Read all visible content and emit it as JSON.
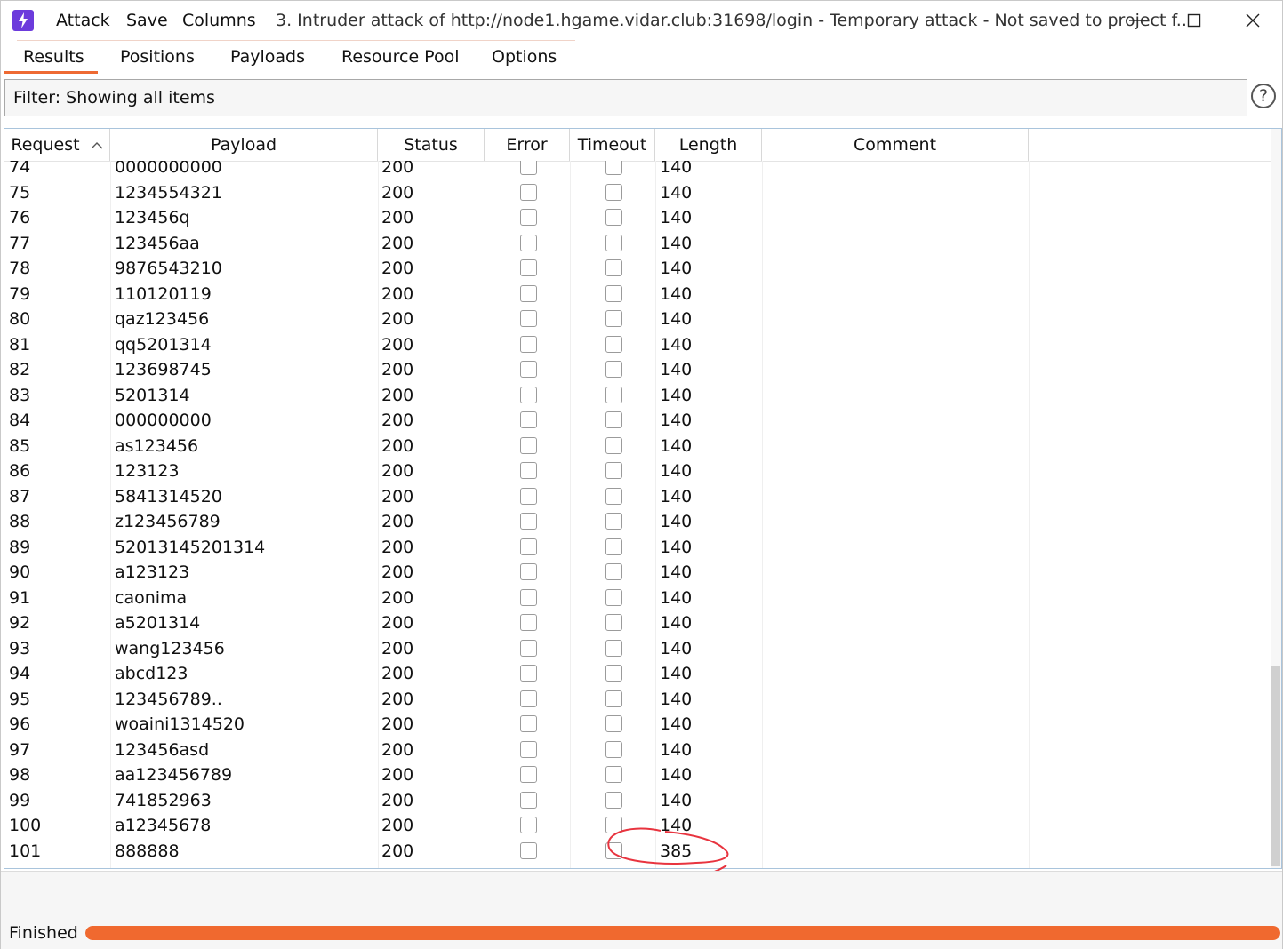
{
  "window": {
    "title": "3. Intruder attack of http://node1.hgame.vidar.club:31698/login - Temporary attack - Not saved to project f..",
    "menu": [
      "Attack",
      "Save",
      "Columns"
    ],
    "app_icon": "burp-lightning-icon"
  },
  "tabs": [
    "Results",
    "Positions",
    "Payloads",
    "Resource Pool",
    "Options"
  ],
  "active_tab": "Results",
  "filter": {
    "text": "Filter: Showing all items"
  },
  "table": {
    "columns": [
      "Request",
      "Payload",
      "Status",
      "Error",
      "Timeout",
      "Length",
      "Comment"
    ],
    "sort_column": "Request",
    "sort_direction": "ascending",
    "rows": [
      {
        "request": "74",
        "payload": "0000000000",
        "status": "200",
        "error": false,
        "timeout": false,
        "length": "140"
      },
      {
        "request": "75",
        "payload": "1234554321",
        "status": "200",
        "error": false,
        "timeout": false,
        "length": "140"
      },
      {
        "request": "76",
        "payload": "123456q",
        "status": "200",
        "error": false,
        "timeout": false,
        "length": "140"
      },
      {
        "request": "77",
        "payload": "123456aa",
        "status": "200",
        "error": false,
        "timeout": false,
        "length": "140"
      },
      {
        "request": "78",
        "payload": "9876543210",
        "status": "200",
        "error": false,
        "timeout": false,
        "length": "140"
      },
      {
        "request": "79",
        "payload": "110120119",
        "status": "200",
        "error": false,
        "timeout": false,
        "length": "140"
      },
      {
        "request": "80",
        "payload": "qaz123456",
        "status": "200",
        "error": false,
        "timeout": false,
        "length": "140"
      },
      {
        "request": "81",
        "payload": "qq5201314",
        "status": "200",
        "error": false,
        "timeout": false,
        "length": "140"
      },
      {
        "request": "82",
        "payload": "123698745",
        "status": "200",
        "error": false,
        "timeout": false,
        "length": "140"
      },
      {
        "request": "83",
        "payload": "5201314",
        "status": "200",
        "error": false,
        "timeout": false,
        "length": "140"
      },
      {
        "request": "84",
        "payload": "000000000",
        "status": "200",
        "error": false,
        "timeout": false,
        "length": "140"
      },
      {
        "request": "85",
        "payload": "as123456",
        "status": "200",
        "error": false,
        "timeout": false,
        "length": "140"
      },
      {
        "request": "86",
        "payload": "123123",
        "status": "200",
        "error": false,
        "timeout": false,
        "length": "140"
      },
      {
        "request": "87",
        "payload": "5841314520",
        "status": "200",
        "error": false,
        "timeout": false,
        "length": "140"
      },
      {
        "request": "88",
        "payload": "z123456789",
        "status": "200",
        "error": false,
        "timeout": false,
        "length": "140"
      },
      {
        "request": "89",
        "payload": "52013145201314",
        "status": "200",
        "error": false,
        "timeout": false,
        "length": "140"
      },
      {
        "request": "90",
        "payload": "a123123",
        "status": "200",
        "error": false,
        "timeout": false,
        "length": "140"
      },
      {
        "request": "91",
        "payload": "caonima",
        "status": "200",
        "error": false,
        "timeout": false,
        "length": "140"
      },
      {
        "request": "92",
        "payload": "a5201314",
        "status": "200",
        "error": false,
        "timeout": false,
        "length": "140"
      },
      {
        "request": "93",
        "payload": "wang123456",
        "status": "200",
        "error": false,
        "timeout": false,
        "length": "140"
      },
      {
        "request": "94",
        "payload": "abcd123",
        "status": "200",
        "error": false,
        "timeout": false,
        "length": "140"
      },
      {
        "request": "95",
        "payload": "123456789..",
        "status": "200",
        "error": false,
        "timeout": false,
        "length": "140"
      },
      {
        "request": "96",
        "payload": "woaini1314520",
        "status": "200",
        "error": false,
        "timeout": false,
        "length": "140"
      },
      {
        "request": "97",
        "payload": "123456asd",
        "status": "200",
        "error": false,
        "timeout": false,
        "length": "140"
      },
      {
        "request": "98",
        "payload": "aa123456789",
        "status": "200",
        "error": false,
        "timeout": false,
        "length": "140"
      },
      {
        "request": "99",
        "payload": "741852963",
        "status": "200",
        "error": false,
        "timeout": false,
        "length": "140"
      },
      {
        "request": "100",
        "payload": "a12345678",
        "status": "200",
        "error": false,
        "timeout": false,
        "length": "140"
      },
      {
        "request": "101",
        "payload": "888888",
        "status": "200",
        "error": false,
        "timeout": false,
        "length": "385"
      }
    ]
  },
  "status": {
    "text": "Finished",
    "progress": 1.0
  },
  "colors": {
    "accent": "#f0692f",
    "app_icon": "#6c3bdc",
    "annotation": "#e8343f"
  }
}
